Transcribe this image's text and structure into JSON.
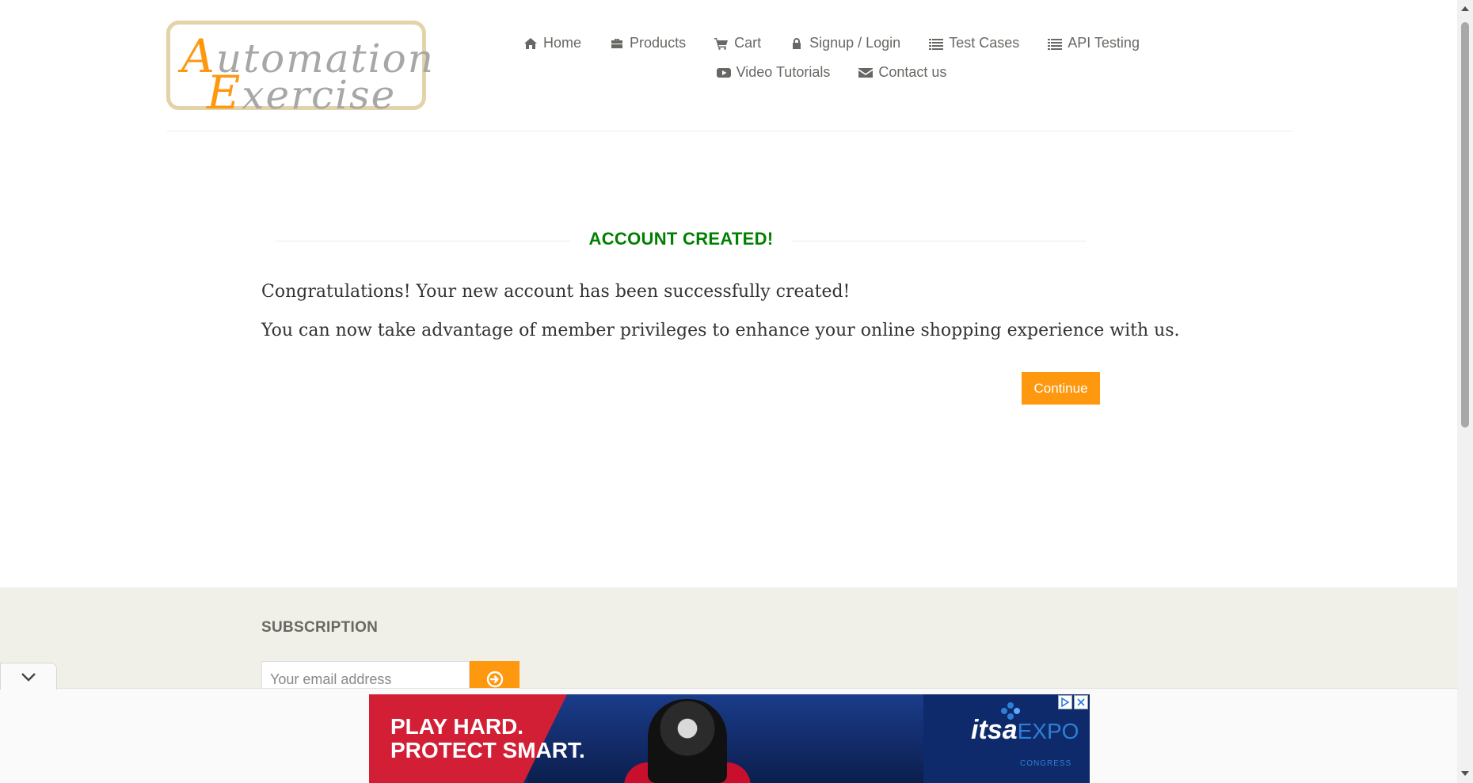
{
  "logo": {
    "line1_cap": "A",
    "line1_rest": "utomation",
    "line2_cap": "E",
    "line2_rest": "xercise"
  },
  "nav": {
    "row1": [
      {
        "label": "Home",
        "icon": "home-icon"
      },
      {
        "label": "Products",
        "icon": "briefcase-icon"
      },
      {
        "label": "Cart",
        "icon": "cart-icon"
      },
      {
        "label": "Signup / Login",
        "icon": "lock-icon"
      },
      {
        "label": "Test Cases",
        "icon": "list-icon"
      },
      {
        "label": "API Testing",
        "icon": "list-icon"
      }
    ],
    "row2": [
      {
        "label": "Video Tutorials",
        "icon": "youtube-icon"
      },
      {
        "label": "Contact us",
        "icon": "envelope-icon"
      }
    ]
  },
  "main": {
    "title": "ACCOUNT CREATED!",
    "message1": "Congratulations! Your new account has been successfully created!",
    "message2": "You can now take advantage of member privileges to enhance your online shopping experience with us.",
    "continue_label": "Continue"
  },
  "footer": {
    "subscription_title": "SUBSCRIPTION",
    "email_placeholder": "Your email address"
  },
  "ad": {
    "headline_line1": "PLAY HARD.",
    "headline_line2": "PROTECT SMART.",
    "logo_it": "it",
    "logo_sa": "sa",
    "logo_expo": "EXPO",
    "logo_congress": "CONGRESS"
  },
  "colors": {
    "accent": "#fe980f",
    "title_green": "#008000",
    "footer_bg": "#f0f0e9",
    "text": "#696763"
  }
}
